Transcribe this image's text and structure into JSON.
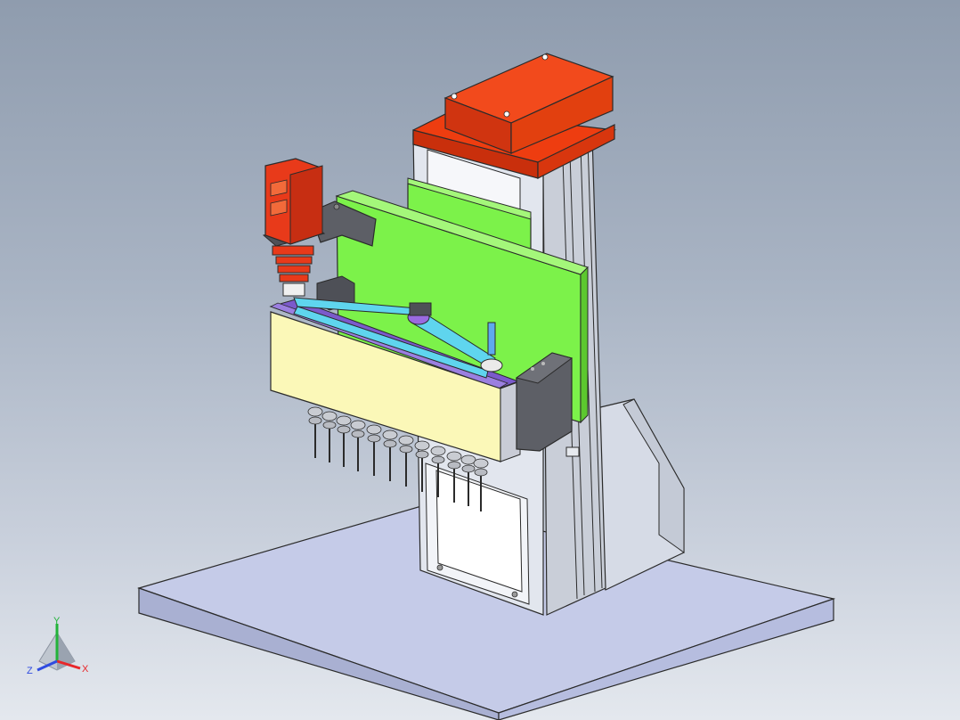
{
  "viewport": {
    "background_top": "#8f9cae",
    "background_bottom": "#e4e8ee"
  },
  "model": {
    "colors": {
      "base_plate": "#c5cbe8",
      "column": "#d8dde6",
      "motor_housing": "#ee3d10",
      "green_plate": "#7cf24a",
      "gearbox_front": "#fbf8b8",
      "dark_block": "#5d5f66",
      "belt": "#5fd5ee",
      "spindle_motor": "#e83a1a"
    }
  },
  "triad": {
    "x_label": "X",
    "y_label": "Y",
    "z_label": "Z",
    "x_color": "#e8262a",
    "y_color": "#22b33a",
    "z_color": "#2f4be0"
  }
}
